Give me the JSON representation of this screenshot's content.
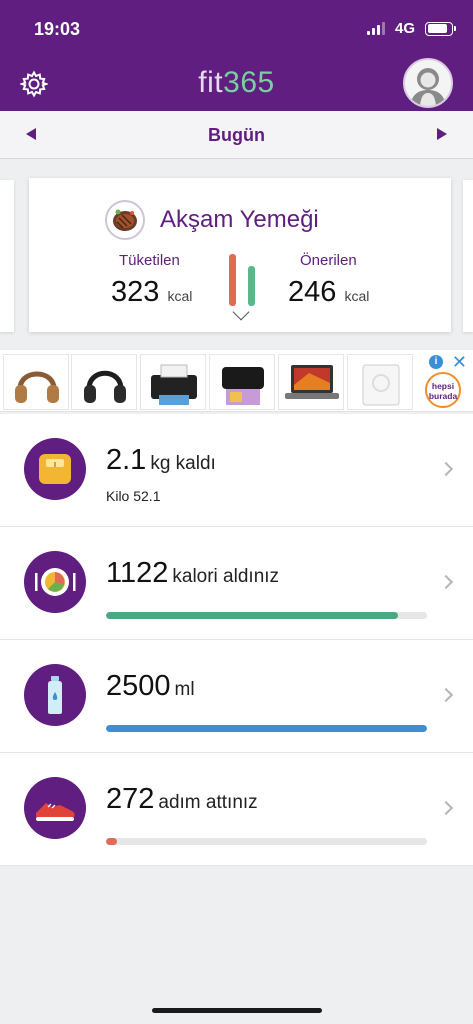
{
  "status_bar": {
    "time": "19:03",
    "network": "4G",
    "battery_level": 0.85
  },
  "header": {
    "logo_part1": "fit",
    "logo_part2": "365",
    "settings_icon": "gear-icon",
    "avatar_icon": "user-avatar-icon"
  },
  "date_nav": {
    "label": "Bugün"
  },
  "meal_card": {
    "title": "Akşam Yemeği",
    "consumed_label": "Tüketilen",
    "consumed_value": "323",
    "recommended_label": "Önerilen",
    "recommended_value": "246",
    "unit": "kcal"
  },
  "ad": {
    "brand_line1": "hepsi",
    "brand_line2": "burada",
    "info_icon": "ad-info-icon",
    "close_label": "✕"
  },
  "stats": [
    {
      "value": "2.1",
      "label": "kg kaldı",
      "sub": "Kilo 52.1",
      "icon": "scale-icon"
    },
    {
      "value": "1122",
      "label": "kalori aldınız",
      "icon": "plate-icon",
      "progress": 0.91,
      "color": "#4aa882"
    },
    {
      "value": "2500",
      "label": "ml",
      "icon": "water-bottle-icon",
      "progress": 1.0,
      "color": "#3d8fd3"
    },
    {
      "value": "272",
      "label": "adım attınız",
      "icon": "sneaker-icon",
      "progress": 0.035,
      "color": "#e06a56"
    }
  ],
  "colors": {
    "brand_purple": "#5f1e80",
    "logo_green": "#78cfa2"
  }
}
